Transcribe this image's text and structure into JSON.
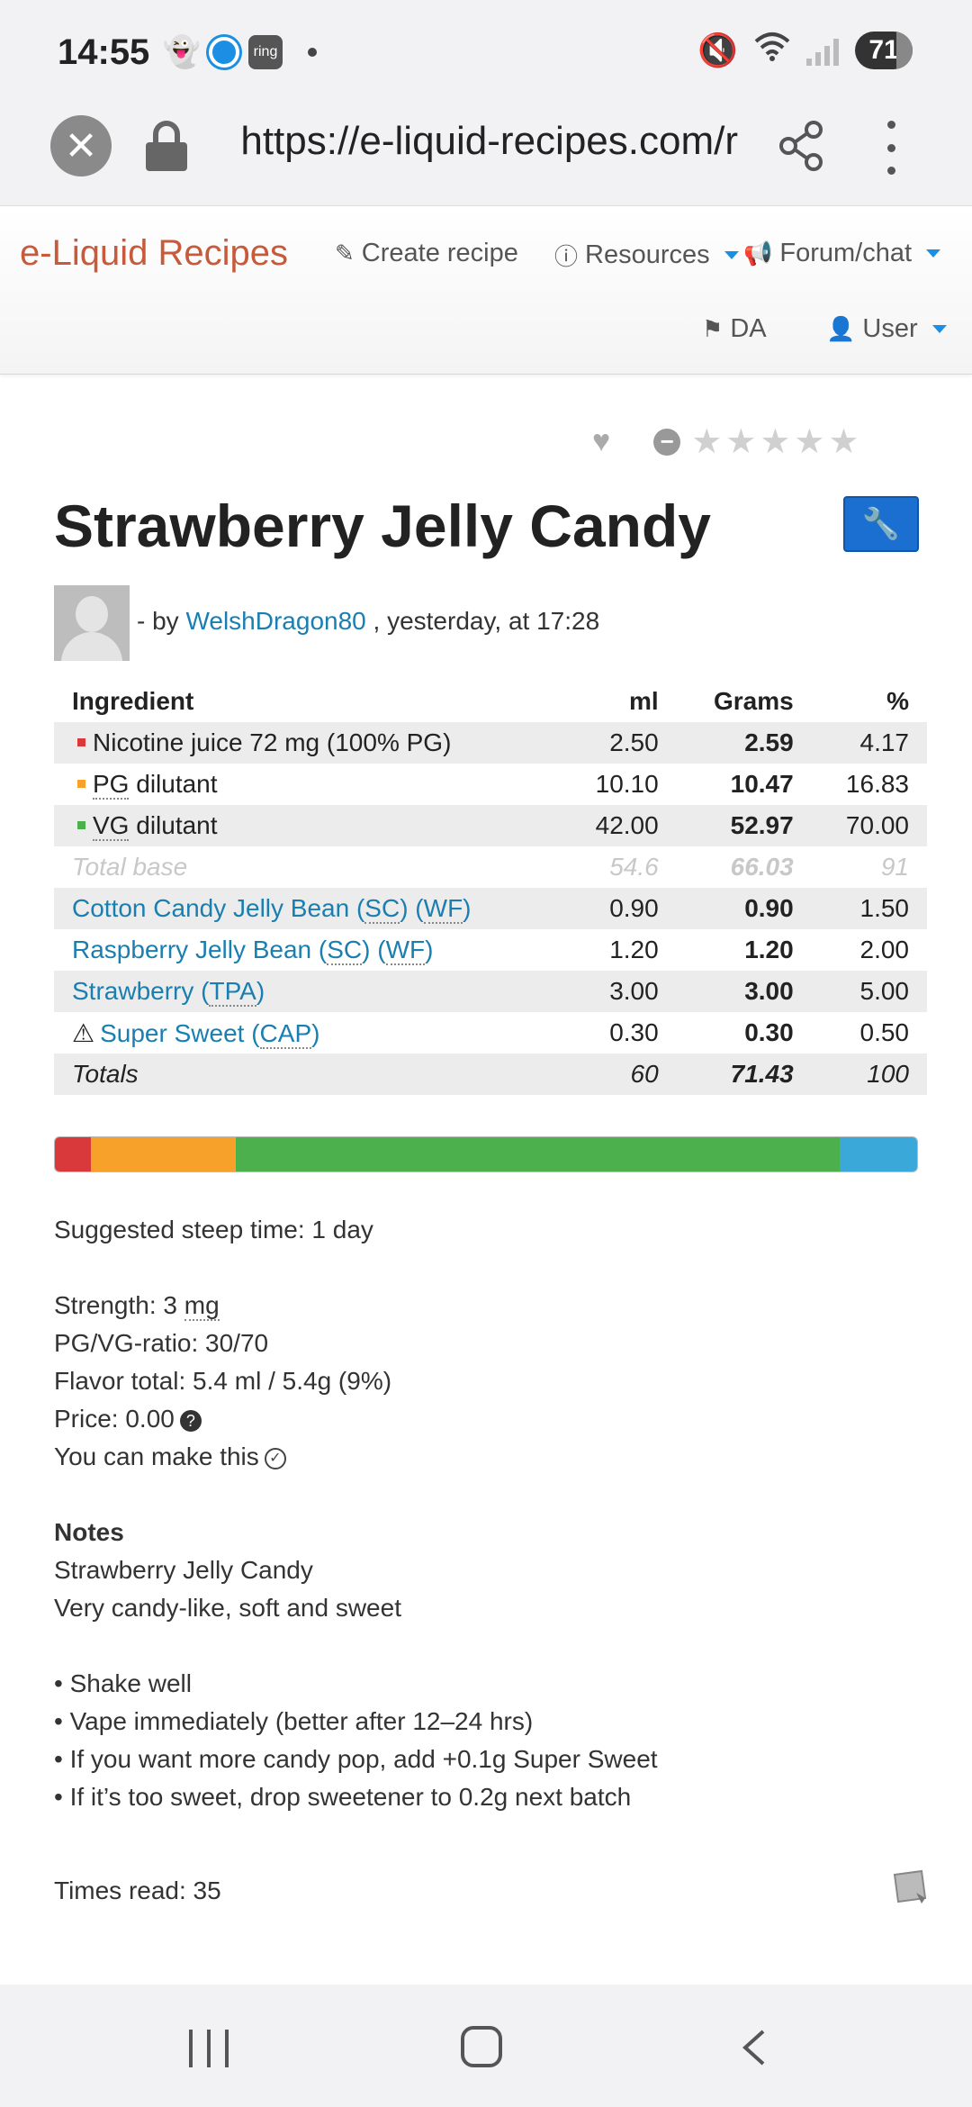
{
  "status_bar": {
    "time": "14:55",
    "left_icons": [
      "snapchat-icon",
      "circle-app-icon",
      "ring-icon",
      "dot-icon"
    ],
    "ring_label": "ring",
    "right_icons": [
      "mute-icon",
      "wifi-icon",
      "signal-icon"
    ],
    "battery": "71"
  },
  "browser": {
    "url": "https://e-liquid-recipes.com/r"
  },
  "site_nav": {
    "brand": "e-Liquid Recipes",
    "create_recipe": "Create recipe",
    "resources": "Resources",
    "forum_chat": "Forum/chat",
    "language": "DA",
    "user": "User",
    "accent": "#1a8fe3"
  },
  "recipe": {
    "title": "Strawberry Jelly Candy",
    "by_prefix": "- by",
    "author": "WelshDragon80",
    "posted": ", yesterday, at 17:28",
    "rating_stars": 0,
    "table": {
      "headers": [
        "Ingredient",
        "ml",
        "Grams",
        "%"
      ],
      "base_rows": [
        {
          "name": "Nicotine juice 72 mg (100% PG)",
          "ml": "2.50",
          "grams": "2.59",
          "pct": "4.17",
          "color": "#d9393b"
        },
        {
          "prefix": "PG",
          "name": " dilutant",
          "ml": "10.10",
          "grams": "10.47",
          "pct": "16.83",
          "color": "#f7a02a"
        },
        {
          "prefix": "VG",
          "name": " dilutant",
          "ml": "42.00",
          "grams": "52.97",
          "pct": "70.00",
          "color": "#4cb04c"
        }
      ],
      "total_base": {
        "label": "Total base",
        "ml": "54.6",
        "grams": "66.03",
        "pct": "91"
      },
      "flavors": [
        {
          "name": "Cotton Candy Jelly Bean",
          "tags": [
            "SC",
            "WF"
          ],
          "ml": "0.90",
          "grams": "0.90",
          "pct": "1.50"
        },
        {
          "name": "Raspberry Jelly Bean",
          "tags": [
            "SC",
            "WF"
          ],
          "ml": "1.20",
          "grams": "1.20",
          "pct": "2.00"
        },
        {
          "name": "Strawberry",
          "tags": [
            "TPA"
          ],
          "ml": "3.00",
          "grams": "3.00",
          "pct": "5.00"
        },
        {
          "name": "Super Sweet",
          "tags": [
            "CAP"
          ],
          "ml": "0.30",
          "grams": "0.30",
          "pct": "0.50",
          "warning": true
        }
      ],
      "totals": {
        "label": "Totals",
        "ml": "60",
        "grams": "71.43",
        "pct": "100"
      }
    },
    "ratio_bar": [
      {
        "name": "nicotine",
        "pct": 4.17,
        "color": "#d9393b"
      },
      {
        "name": "pg",
        "pct": 16.83,
        "color": "#f7a02a"
      },
      {
        "name": "vg",
        "pct": 70.0,
        "color": "#4cb04c"
      },
      {
        "name": "flavor",
        "pct": 9.0,
        "color": "#3aa8d8"
      }
    ],
    "steep": "Suggested steep time: 1 day",
    "strength_label": "Strength: 3 ",
    "strength_unit": "mg",
    "ratio": "PG/VG-ratio: 30/70",
    "flavor_total": "Flavor total: 5.4 ml / 5.4g (9%)",
    "price": "Price: 0.00",
    "can_make": "You can make this",
    "notes_heading": "Notes",
    "notes": [
      "Strawberry Jelly Candy",
      "Very candy-like, soft and sweet",
      "",
      "• Shake well",
      "• Vape immediately (better after 12–24 hrs)",
      "• If you want more candy pop, add +0.1g Super Sweet",
      "• If it’s too sweet, drop sweetener to 0.2g next batch"
    ],
    "times_read": "Times read: 35"
  }
}
